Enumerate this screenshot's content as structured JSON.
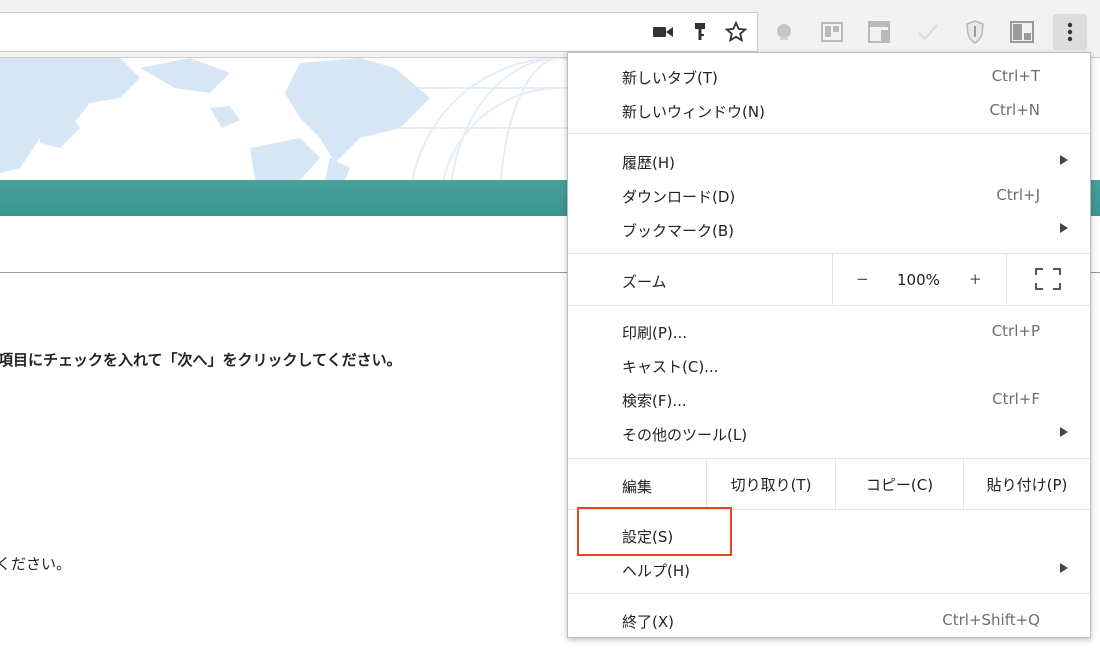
{
  "toolbar": {
    "icons": [
      "camera-icon",
      "key-icon",
      "star-icon",
      "extension-circle-icon",
      "extension-board-icon",
      "extension-window-icon",
      "extension-check-icon",
      "extension-shield-icon",
      "extension-split-icon",
      "menu-dots-icon"
    ]
  },
  "page": {
    "instruction_line": "項目にチェックを入れて「次へ」をクリックしてください。",
    "second_line": "ください。"
  },
  "menu": {
    "new_tab": {
      "label": "新しいタブ(T)",
      "shortcut": "Ctrl+T"
    },
    "new_window": {
      "label": "新しいウィンドウ(N)",
      "shortcut": "Ctrl+N"
    },
    "history": {
      "label": "履歴(H)"
    },
    "downloads": {
      "label": "ダウンロード(D)",
      "shortcut": "Ctrl+J"
    },
    "bookmarks": {
      "label": "ブックマーク(B)"
    },
    "zoom": {
      "label": "ズーム",
      "minus": "−",
      "value": "100%",
      "plus": "+"
    },
    "print": {
      "label": "印刷(P)...",
      "shortcut": "Ctrl+P"
    },
    "cast": {
      "label": "キャスト(C)..."
    },
    "find": {
      "label": "検索(F)...",
      "shortcut": "Ctrl+F"
    },
    "more_tools": {
      "label": "その他のツール(L)"
    },
    "edit": {
      "label": "編集",
      "cut": "切り取り(T)",
      "copy": "コピー(C)",
      "paste": "貼り付け(P)"
    },
    "settings": {
      "label": "設定(S)"
    },
    "help": {
      "label": "ヘルプ(H)"
    },
    "exit": {
      "label": "終了(X)",
      "shortcut": "Ctrl+Shift+Q"
    }
  },
  "colors": {
    "highlight_border": "#e4461f",
    "teal_band": "#3f9a94",
    "map_land": "#d6e6f4"
  }
}
